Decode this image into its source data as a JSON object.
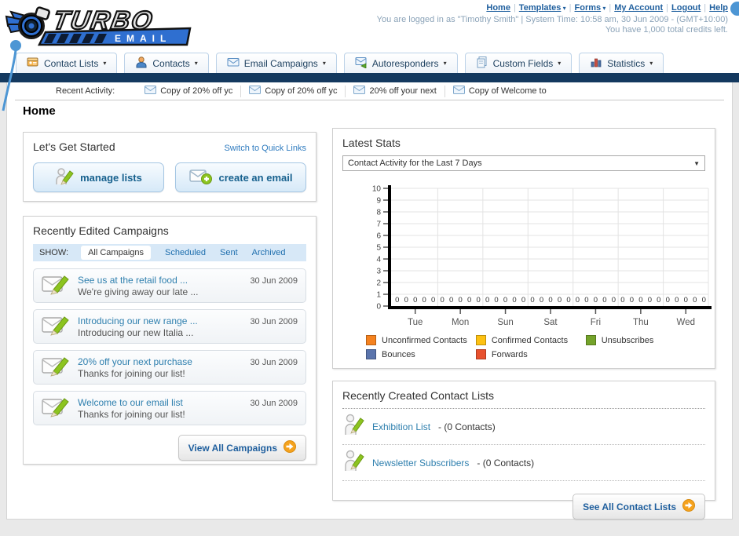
{
  "header": {
    "logo_title": "TURBO",
    "logo_subtitle": "EMAIL",
    "nav_links": [
      {
        "label": "Home",
        "dropdown": false
      },
      {
        "label": "Templates",
        "dropdown": true
      },
      {
        "label": "Forms",
        "dropdown": true
      },
      {
        "label": "My Account",
        "dropdown": false
      },
      {
        "label": "Logout",
        "dropdown": false
      },
      {
        "label": "Help",
        "dropdown": false
      }
    ],
    "login_info": "You are logged in as \"Timothy Smith\" | System Time: 10:58 am, 30 Jun 2009 - (GMT+10:00)",
    "credits_info": "You have 1,000 total credits left."
  },
  "menu": {
    "tabs": [
      {
        "label": "Contact Lists",
        "icon": "contact-card-icon"
      },
      {
        "label": "Contacts",
        "icon": "contacts-icon"
      },
      {
        "label": "Email Campaigns",
        "icon": "email-campaigns-icon"
      },
      {
        "label": "Autoresponders",
        "icon": "autoresponders-icon"
      },
      {
        "label": "Custom Fields",
        "icon": "custom-fields-icon"
      },
      {
        "label": "Statistics",
        "icon": "statistics-icon"
      }
    ]
  },
  "recent_activity": {
    "label": "Recent Activity:",
    "items": [
      {
        "text": "Copy of 20% off yc"
      },
      {
        "text": "Copy of 20% off yc"
      },
      {
        "text": "20% off your next "
      },
      {
        "text": "Copy of Welcome to"
      }
    ]
  },
  "page_title": "Home",
  "get_started": {
    "title": "Let's Get Started",
    "switch_link": "Switch to Quick Links",
    "buttons": [
      {
        "label": "manage lists",
        "icon": "person-pencil-icon"
      },
      {
        "label": "create an email",
        "icon": "envelope-plus-icon"
      }
    ]
  },
  "campaigns": {
    "title": "Recently Edited Campaigns",
    "show_label": "SHOW:",
    "filters": [
      "All Campaigns",
      "Scheduled",
      "Sent",
      "Archived"
    ],
    "active_filter": "All Campaigns",
    "items": [
      {
        "title": "See us at the retail food ...",
        "subtitle": "We're giving away our late ...",
        "date": "30 Jun 2009"
      },
      {
        "title": "Introducing our new range ...",
        "subtitle": "Introducing our new Italia ...",
        "date": "30 Jun 2009"
      },
      {
        "title": "20% off your next purchase",
        "subtitle": "Thanks for joining our list!",
        "date": "30 Jun 2009"
      },
      {
        "title": "Welcome to our email list",
        "subtitle": "Thanks for joining our list!",
        "date": "30 Jun 2009"
      }
    ],
    "view_all_label": "View All Campaigns"
  },
  "stats": {
    "title": "Latest Stats",
    "dropdown_value": "Contact Activity for the Last 7 Days"
  },
  "chart_data": {
    "type": "bar",
    "title": "Contact Activity for the Last 7 Days",
    "categories": [
      "Tue",
      "Mon",
      "Sun",
      "Sat",
      "Fri",
      "Thu",
      "Wed"
    ],
    "series": [
      {
        "name": "Unconfirmed Contacts",
        "color": "#f5821f",
        "values": [
          0,
          0,
          0,
          0,
          0,
          0,
          0
        ]
      },
      {
        "name": "Confirmed Contacts",
        "color": "#fdc112",
        "values": [
          0,
          0,
          0,
          0,
          0,
          0,
          0
        ]
      },
      {
        "name": "Unsubscribes",
        "color": "#74a32a",
        "values": [
          0,
          0,
          0,
          0,
          0,
          0,
          0
        ]
      },
      {
        "name": "Bounces",
        "color": "#5a74ac",
        "values": [
          0,
          0,
          0,
          0,
          0,
          0,
          0
        ]
      },
      {
        "name": "Forwards",
        "color": "#e8512e",
        "values": [
          0,
          0,
          0,
          0,
          0,
          0,
          0
        ]
      }
    ],
    "ylim": [
      0,
      10
    ],
    "yticks": [
      0,
      1,
      2,
      3,
      4,
      5,
      6,
      7,
      8,
      9,
      10
    ],
    "grid": true,
    "value_labels": true,
    "legend_position": "bottom"
  },
  "contact_lists": {
    "title": "Recently Created Contact Lists",
    "items": [
      {
        "name": "Exhibition List",
        "count": "- (0 Contacts)"
      },
      {
        "name": "Newsletter Subscribers",
        "count": "- (0 Contacts)"
      }
    ],
    "see_all_label": "See All Contact Lists"
  }
}
